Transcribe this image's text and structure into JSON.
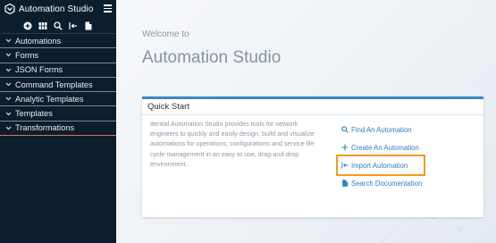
{
  "app": {
    "title": "Automation Studio"
  },
  "sidebar": {
    "items": [
      {
        "label": "Automations"
      },
      {
        "label": "Forms"
      },
      {
        "label": "JSON Forms"
      },
      {
        "label": "Command Templates"
      },
      {
        "label": "Analytic Templates"
      },
      {
        "label": "Templates"
      },
      {
        "label": "Transformations"
      }
    ]
  },
  "toolbar": {
    "icons": [
      "add-icon",
      "grid-icon",
      "search-icon",
      "import-icon",
      "document-icon"
    ]
  },
  "main": {
    "welcome": "Welcome to",
    "title": "Automation Studio",
    "quick_start": {
      "title": "Quick Start",
      "description": "Itential Automation Studio provides tools for network engineers to quickly and easily design, build and visualize automations for operations, configurations and service life cycle management in an easy to use, drag-and-drop environment.",
      "actions": [
        {
          "label": "Find An Automation",
          "icon": "search-icon"
        },
        {
          "label": "Create An Automation",
          "icon": "plus-icon"
        },
        {
          "label": "Import Automation",
          "icon": "import-icon"
        },
        {
          "label": "Search Documentation",
          "icon": "document-icon"
        }
      ]
    }
  },
  "colors": {
    "sidebar_bg": "#0c1d2e",
    "accent": "#2f7fc0",
    "highlight": "#f29b1d",
    "card_border": "#3f87c6",
    "active_divider": "#e0753a"
  }
}
